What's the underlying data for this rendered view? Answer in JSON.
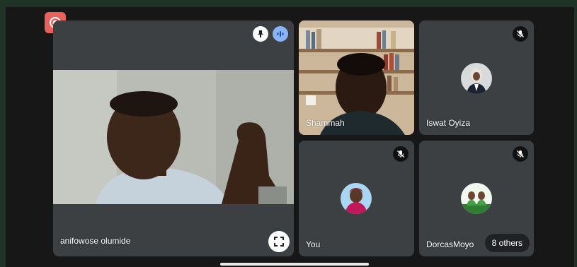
{
  "participants": {
    "main": {
      "name": "anifowose olumide"
    },
    "shammah": {
      "name": "Shammah"
    },
    "iswat": {
      "name": "Iswat Oyiza"
    },
    "you": {
      "name": "You"
    },
    "dorcas": {
      "name": "DorcasMoyo"
    }
  },
  "others_label": "8 others",
  "icons": {
    "record": "record-icon",
    "pin": "pin-icon",
    "speaking": "speaking-icon",
    "mute": "mic-off-icon",
    "fullscreen": "fullscreen-icon"
  },
  "colors": {
    "record": "#e8615b",
    "speaking": "#8ab4f8",
    "tile": "#3c4043"
  }
}
